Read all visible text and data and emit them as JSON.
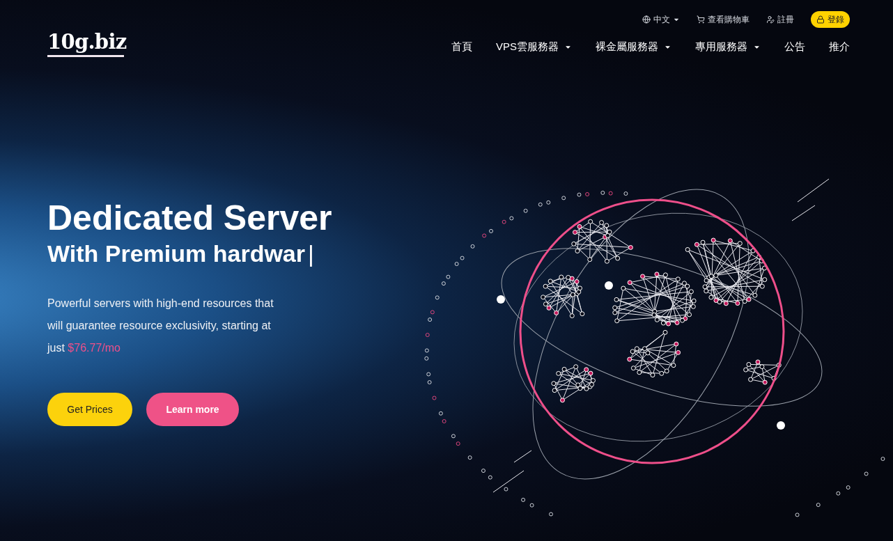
{
  "header": {
    "logo": "10g.biz",
    "top_links": [
      {
        "kind": "language",
        "label": "中文",
        "dropdown": true
      },
      {
        "kind": "cart",
        "label": "查看購物車",
        "dropdown": false
      },
      {
        "kind": "register",
        "label": "註冊",
        "dropdown": false
      },
      {
        "kind": "login",
        "label": "登錄",
        "dropdown": false
      }
    ],
    "nav": [
      {
        "label": "首頁",
        "dropdown": false
      },
      {
        "label": "VPS雲服務器",
        "dropdown": true
      },
      {
        "label": "裸金屬服務器",
        "dropdown": true
      },
      {
        "label": "專用服務器",
        "dropdown": true
      },
      {
        "label": "公告",
        "dropdown": false
      },
      {
        "label": "推介",
        "dropdown": false
      }
    ]
  },
  "hero": {
    "title": "Dedicated Server",
    "subtitle": "With Premium hardwar",
    "cursor": "|",
    "description": "Powerful servers with high-end resources that will guarantee resource exclusivity, starting at just",
    "price": "$76.77/mo",
    "buttons": [
      {
        "kind": "primary",
        "label": "Get Prices"
      },
      {
        "kind": "secondary",
        "label": "Learn more"
      }
    ]
  }
}
